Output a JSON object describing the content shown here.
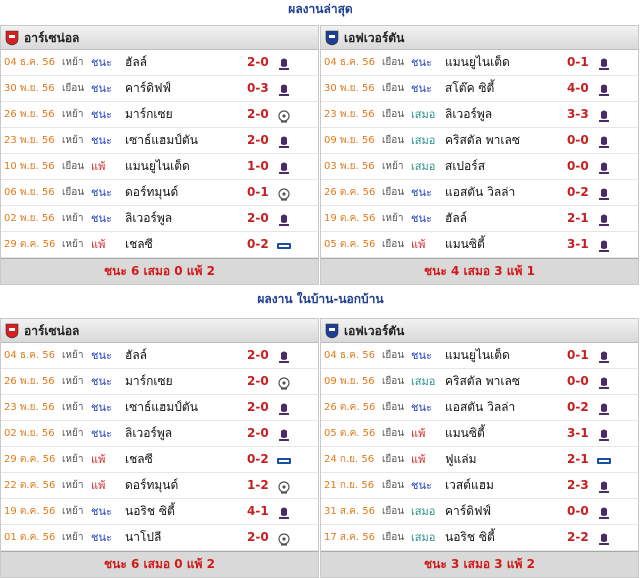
{
  "sections": [
    {
      "title": "ผลงานล่าสุด",
      "left": {
        "team": "อาร์เซน่อล",
        "crest_color": "#d42020",
        "rows": [
          {
            "date": "04 ธ.ค. 56",
            "ha": "เหย้า",
            "result": "ชนะ",
            "type": "w",
            "opponent": "ฮัลล์",
            "score": "2-0",
            "comp": "premier-league-icon"
          },
          {
            "date": "30 พ.ย. 56",
            "ha": "เยือน",
            "result": "ชนะ",
            "type": "w",
            "opponent": "คาร์ดิฟฟ์",
            "score": "0-3",
            "comp": "premier-league-icon"
          },
          {
            "date": "26 พ.ย. 56",
            "ha": "เหย้า",
            "result": "ชนะ",
            "type": "w",
            "opponent": "มาร์กเซย",
            "score": "2-0",
            "comp": "champions-league-icon"
          },
          {
            "date": "23 พ.ย. 56",
            "ha": "เหย้า",
            "result": "ชนะ",
            "type": "w",
            "opponent": "เซาธ์แฮมป์ตัน",
            "score": "2-0",
            "comp": "premier-league-icon"
          },
          {
            "date": "10 พ.ย. 56",
            "ha": "เยือน",
            "result": "แพ้",
            "type": "l",
            "opponent": "แมนยูไนเต็ด",
            "score": "1-0",
            "comp": "premier-league-icon"
          },
          {
            "date": "06 พ.ย. 56",
            "ha": "เยือน",
            "result": "ชนะ",
            "type": "w",
            "opponent": "ดอร์ทมุนด์",
            "score": "0-1",
            "comp": "champions-league-icon"
          },
          {
            "date": "02 พ.ย. 56",
            "ha": "เหย้า",
            "result": "ชนะ",
            "type": "w",
            "opponent": "ลิเวอร์พูล",
            "score": "2-0",
            "comp": "premier-league-icon"
          },
          {
            "date": "29 ต.ค. 56",
            "ha": "เหย้า",
            "result": "แพ้",
            "type": "l",
            "opponent": "เชลซี",
            "score": "0-2",
            "comp": "league-cup-icon"
          }
        ],
        "summary": "ชนะ 6 เสมอ 0 แพ้ 2"
      },
      "right": {
        "team": "เอฟเวอร์ตัน",
        "crest_color": "#1c3f94",
        "rows": [
          {
            "date": "04 ธ.ค. 56",
            "ha": "เยือน",
            "result": "ชนะ",
            "type": "w",
            "opponent": "แมนยูไนเต็ด",
            "score": "0-1",
            "comp": "premier-league-icon"
          },
          {
            "date": "30 พ.ย. 56",
            "ha": "เยือน",
            "result": "ชนะ",
            "type": "w",
            "opponent": "สโต๊ค ซิตี้",
            "score": "4-0",
            "comp": "premier-league-icon"
          },
          {
            "date": "23 พ.ย. 56",
            "ha": "เยือน",
            "result": "เสมอ",
            "type": "d",
            "opponent": "ลิเวอร์พูล",
            "score": "3-3",
            "comp": "premier-league-icon"
          },
          {
            "date": "09 พ.ย. 56",
            "ha": "เยือน",
            "result": "เสมอ",
            "type": "d",
            "opponent": "คริสตัล พาเลซ",
            "score": "0-0",
            "comp": "premier-league-icon"
          },
          {
            "date": "03 พ.ย. 56",
            "ha": "เหย้า",
            "result": "เสมอ",
            "type": "d",
            "opponent": "สเปอร์ส",
            "score": "0-0",
            "comp": "premier-league-icon"
          },
          {
            "date": "26 ต.ค. 56",
            "ha": "เยือน",
            "result": "ชนะ",
            "type": "w",
            "opponent": "แอสตัน วิลล่า",
            "score": "0-2",
            "comp": "premier-league-icon"
          },
          {
            "date": "19 ต.ค. 56",
            "ha": "เหย้า",
            "result": "ชนะ",
            "type": "w",
            "opponent": "ฮัลล์",
            "score": "2-1",
            "comp": "premier-league-icon"
          },
          {
            "date": "05 ต.ค. 56",
            "ha": "เยือน",
            "result": "แพ้",
            "type": "l",
            "opponent": "แมนซิตี้",
            "score": "3-1",
            "comp": "premier-league-icon"
          }
        ],
        "summary": "ชนะ 4 เสมอ 3 แพ้ 1"
      }
    },
    {
      "title": "ผลงาน ในบ้าน-นอกบ้าน",
      "left": {
        "team": "อาร์เซน่อล",
        "crest_color": "#d42020",
        "rows": [
          {
            "date": "04 ธ.ค. 56",
            "ha": "เหย้า",
            "result": "ชนะ",
            "type": "w",
            "opponent": "ฮัลล์",
            "score": "2-0",
            "comp": "premier-league-icon"
          },
          {
            "date": "26 พ.ย. 56",
            "ha": "เหย้า",
            "result": "ชนะ",
            "type": "w",
            "opponent": "มาร์กเซย",
            "score": "2-0",
            "comp": "champions-league-icon"
          },
          {
            "date": "23 พ.ย. 56",
            "ha": "เหย้า",
            "result": "ชนะ",
            "type": "w",
            "opponent": "เซาธ์แฮมป์ตัน",
            "score": "2-0",
            "comp": "premier-league-icon"
          },
          {
            "date": "02 พ.ย. 56",
            "ha": "เหย้า",
            "result": "ชนะ",
            "type": "w",
            "opponent": "ลิเวอร์พูล",
            "score": "2-0",
            "comp": "premier-league-icon"
          },
          {
            "date": "29 ต.ค. 56",
            "ha": "เหย้า",
            "result": "แพ้",
            "type": "l",
            "opponent": "เชลซี",
            "score": "0-2",
            "comp": "league-cup-icon"
          },
          {
            "date": "22 ต.ค. 56",
            "ha": "เหย้า",
            "result": "แพ้",
            "type": "l",
            "opponent": "ดอร์ทมุนด์",
            "score": "1-2",
            "comp": "champions-league-icon"
          },
          {
            "date": "19 ต.ค. 56",
            "ha": "เหย้า",
            "result": "ชนะ",
            "type": "w",
            "opponent": "นอริช ซิตี้",
            "score": "4-1",
            "comp": "premier-league-icon"
          },
          {
            "date": "01 ต.ค. 56",
            "ha": "เหย้า",
            "result": "ชนะ",
            "type": "w",
            "opponent": "นาโปลี",
            "score": "2-0",
            "comp": "champions-league-icon"
          }
        ],
        "summary": "ชนะ 6 เสมอ 0 แพ้ 2"
      },
      "right": {
        "team": "เอฟเวอร์ตัน",
        "crest_color": "#1c3f94",
        "rows": [
          {
            "date": "04 ธ.ค. 56",
            "ha": "เยือน",
            "result": "ชนะ",
            "type": "w",
            "opponent": "แมนยูไนเต็ด",
            "score": "0-1",
            "comp": "premier-league-icon"
          },
          {
            "date": "09 พ.ย. 56",
            "ha": "เยือน",
            "result": "เสมอ",
            "type": "d",
            "opponent": "คริสตัล พาเลซ",
            "score": "0-0",
            "comp": "premier-league-icon"
          },
          {
            "date": "26 ต.ค. 56",
            "ha": "เยือน",
            "result": "ชนะ",
            "type": "w",
            "opponent": "แอสตัน วิลล่า",
            "score": "0-2",
            "comp": "premier-league-icon"
          },
          {
            "date": "05 ต.ค. 56",
            "ha": "เยือน",
            "result": "แพ้",
            "type": "l",
            "opponent": "แมนซิตี้",
            "score": "3-1",
            "comp": "premier-league-icon"
          },
          {
            "date": "24 ก.ย. 56",
            "ha": "เยือน",
            "result": "แพ้",
            "type": "l",
            "opponent": "ฟูแล่ม",
            "score": "2-1",
            "comp": "league-cup-icon"
          },
          {
            "date": "21 ก.ย. 56",
            "ha": "เยือน",
            "result": "ชนะ",
            "type": "w",
            "opponent": "เวสต์แฮม",
            "score": "2-3",
            "comp": "premier-league-icon"
          },
          {
            "date": "31 ส.ค. 56",
            "ha": "เยือน",
            "result": "เสมอ",
            "type": "d",
            "opponent": "คาร์ดิฟฟ์",
            "score": "0-0",
            "comp": "premier-league-icon"
          },
          {
            "date": "17 ส.ค. 56",
            "ha": "เยือน",
            "result": "เสมอ",
            "type": "d",
            "opponent": "นอริช ซิตี้",
            "score": "2-2",
            "comp": "premier-league-icon"
          }
        ],
        "summary": "ชนะ 3 เสมอ 3 แพ้ 2"
      }
    }
  ]
}
